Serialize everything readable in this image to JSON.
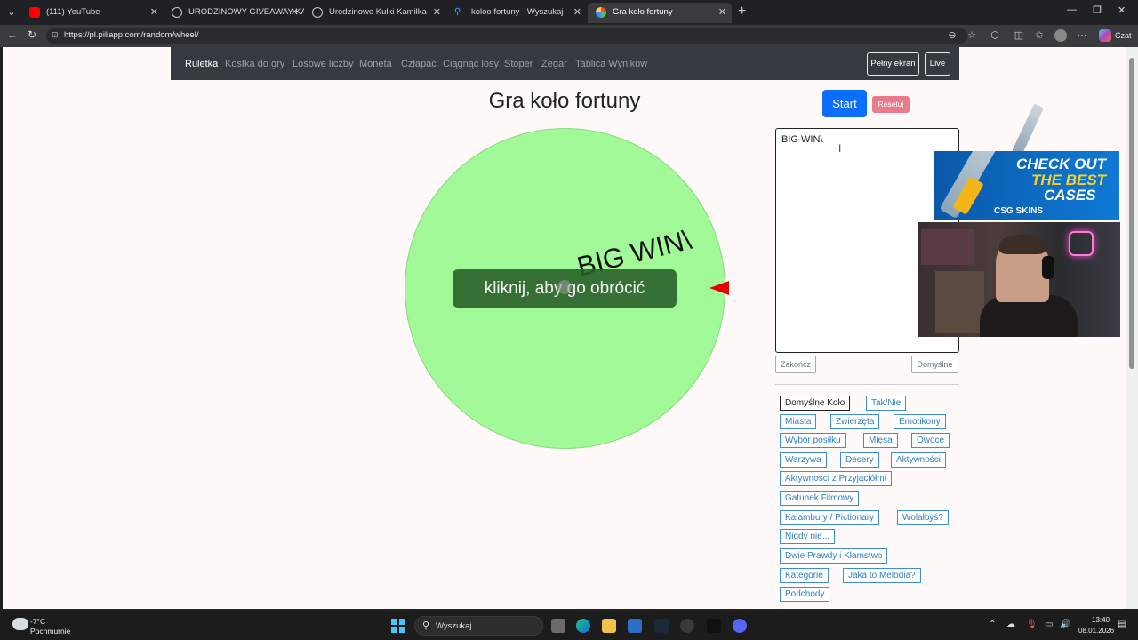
{
  "browser": {
    "tabs": [
      {
        "label": "(111) YouTube"
      },
      {
        "label": "URODZINOWY GIVEAWAY KAMILK"
      },
      {
        "label": "Urodzinowe Kulki Kamilka"
      },
      {
        "label": "koloo fortuny - Wyszukaj"
      },
      {
        "label": "Gra koło fortuny"
      }
    ],
    "url": "https://pl.piliapp.com/random/wheel/",
    "chat_label": "Czat"
  },
  "site": {
    "nav": [
      "Ruletka",
      "Kostka do gry",
      "Losowe liczby",
      "Moneta",
      "Człapać",
      "Ciągnąć losy",
      "Stoper",
      "Zegar",
      "Tablica Wyników"
    ],
    "fullscreen_label": "Pełny ekran",
    "live_label": "Live",
    "title": "Gra koło fortuny",
    "start_label": "Start",
    "reset_label": "Resetuj",
    "wheel_entry": "BIG WIN\\",
    "spin_prompt": "kliknij, aby go obrócić",
    "entries_text": "BIG WIN\\",
    "finish_label": "Zakończ",
    "default_label": "Domyślne",
    "presets": [
      "Domyślne Koło",
      "Tak/Nie",
      "Miasta",
      "Zwierzęta",
      "Emotikony",
      "Wybór posiłku",
      "Mięsa",
      "Owoce",
      "Warzywa",
      "Desery",
      "Aktywności",
      "Aktywności z Przyjaciółmi",
      "Gatunek Filmowy",
      "Kalambury / Pictionary",
      "Wolałbyś?",
      "Nigdy nie...",
      "Dwie Prawdy i Kłamstwo",
      "Kategorie",
      "Jaka to Melodia?",
      "Podchody"
    ],
    "wheel_color": "#a1fa97"
  },
  "ad": {
    "line1": "CHECK OUT",
    "line2": "THE BEST",
    "line3": "CASES",
    "logo": "CSG SKINS"
  },
  "taskbar": {
    "temperature": "-7°C",
    "weather": "Pochmurnie",
    "search_label": "Wyszukaj",
    "time": "13:40",
    "date": "08.01.2026"
  }
}
